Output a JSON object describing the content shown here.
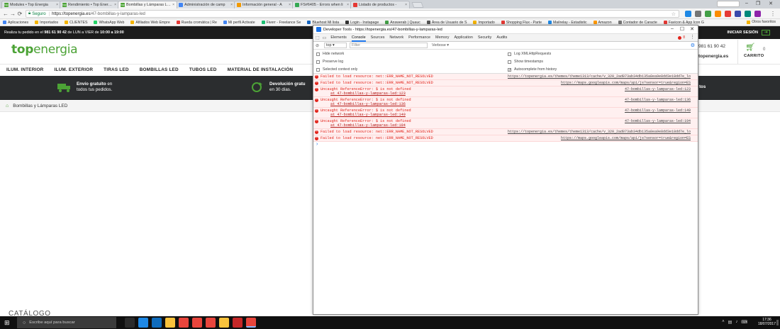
{
  "browser": {
    "tabs": [
      {
        "label": "Modules • Top Energia",
        "favicon_color": "#4ca336",
        "favicon_text": "top",
        "active": false
      },
      {
        "label": "Rendimiento • Top Energia",
        "favicon_color": "#4ca336",
        "favicon_text": "top",
        "active": false
      },
      {
        "label": "Bombillas y Lámparas LED",
        "favicon_color": "#4ca336",
        "favicon_text": "top",
        "active": true
      },
      {
        "label": "Administración de camp",
        "favicon_color": "#4285f4",
        "favicon_text": "",
        "active": false
      },
      {
        "label": "Información general - A",
        "favicon_color": "#f29900",
        "favicon_text": "",
        "active": false
      },
      {
        "label": "FS#6405 - Errors when li",
        "favicon_color": "#34a853",
        "favicon_text": "",
        "active": false
      },
      {
        "label": "Listado de productos - ",
        "favicon_color": "#e53935",
        "favicon_text": "",
        "active": false
      }
    ],
    "address": {
      "secure_label": "Seguro",
      "url_host": "https://topenergia.es",
      "url_path": "/47-bombillas-y-lamparas-led"
    },
    "bookmarks": [
      {
        "label": "Aplicaciones",
        "color": "#4285f4"
      },
      {
        "label": "Importados",
        "color": "#f4b400"
      },
      {
        "label": "CLIENTES",
        "color": "#f4b400"
      },
      {
        "label": "WhatsApp Web",
        "color": "#25d366"
      },
      {
        "label": "Afiliados Web Empre",
        "color": "#f4b400"
      },
      {
        "label": "Rueda cromática | Re",
        "color": "#e53935"
      },
      {
        "label": "Mi perfil Activate",
        "color": "#4285f4"
      },
      {
        "label": "Fiverr - Freelance Se",
        "color": "#1dbf73"
      },
      {
        "label": "Bluehost Mi lista",
        "color": "#1565c0"
      },
      {
        "label": "Login - Instapage",
        "color": "#333333"
      },
      {
        "label": "Answerab | Quauc",
        "color": "#43a047"
      },
      {
        "label": "Área de Usuario de S",
        "color": "#555555"
      },
      {
        "label": "Importado",
        "color": "#f4b400"
      },
      {
        "label": "Shopping Flux - Parte",
        "color": "#e53935"
      },
      {
        "label": "Mailrelay - Estadistic",
        "color": "#1e88e5"
      },
      {
        "label": "Amazon",
        "color": "#ff9900"
      },
      {
        "label": "Contador de Caracte",
        "color": "#777777"
      },
      {
        "label": "Favicon & App Icon G",
        "color": "#e53935"
      }
    ],
    "other_bookmarks": "Otros favoritos"
  },
  "site": {
    "promo_prefix": "Realiza tu pedido en el ",
    "promo_phone": "981 61 90 42",
    "promo_middle": " de LUN a VIER de ",
    "promo_hours": "10:00 a 19:00",
    "login_label": "INICIAR SESIÓN",
    "logo_top": "top",
    "logo_energia": "energia",
    "phone": "981 61 90 42",
    "domain": "topenergia.es",
    "cart_count": "0",
    "cart_label": "CARRITO",
    "nav": [
      "ILUM. INTERIOR",
      "ILUM. EXTERIOR",
      "TIRAS LED",
      "BOMBILLAS LED",
      "TUBOS LED",
      "MATERIAL DE INSTALACIÓN"
    ],
    "benefits": [
      {
        "title": "Envío gratuito",
        "title_suffix": " en",
        "line2": "todos tus pedidos."
      },
      {
        "title": "Devolución gratu",
        "title_suffix": "",
        "line2": "en 30 días."
      },
      {
        "title": "tos",
        "title_suffix": "",
        "line2": ""
      }
    ],
    "breadcrumb": "Bombillas y Lámparas LED",
    "catalog_heading": "CATÁLOGO"
  },
  "devtools": {
    "title": "Developer Tools - https://topenergia.es/47-bombillas-y-lamparas-led",
    "tabs": [
      "Elements",
      "Console",
      "Sources",
      "Network",
      "Performance",
      "Memory",
      "Application",
      "Security",
      "Audits"
    ],
    "active_tab": "Console",
    "error_count": "8",
    "context": "top",
    "filter_placeholder": "Filter",
    "level": "Verbose",
    "options_left": [
      {
        "label": "Hide network",
        "checked": false
      },
      {
        "label": "Preserve log",
        "checked": false
      },
      {
        "label": "Selected context only",
        "checked": false
      }
    ],
    "options_right": [
      {
        "label": "Log XMLHttpRequests",
        "checked": false
      },
      {
        "label": "Show timestamps",
        "checked": false
      },
      {
        "label": "Autocomplete from history",
        "checked": true
      }
    ],
    "messages": [
      {
        "text": "Failed to load resource: net::ERR_NAME_NOT_RESOLVED",
        "source": "https://topenergia.es/themes/theme1313/cache/v_320_2ad873ab34db135a8ea9e8dd3e18dd7e_lo",
        "stack": ""
      },
      {
        "text": "Failed to load resource: net::ERR_NAME_NOT_RESOLVED",
        "source": "https://maps.googleapis.com/maps/api/js?sensor=true&region=ES",
        "stack": ""
      },
      {
        "text": "Uncaught ReferenceError: $ is not defined",
        "source": "47-bombillas-y-lamparas-led:123",
        "stack": "at 47-bombillas-y-lamparas-led:123"
      },
      {
        "text": "Uncaught ReferenceError: $ is not defined",
        "source": "47-bombillas-y-lamparas-led:136",
        "stack": "at 47-bombillas-y-lamparas-led:136"
      },
      {
        "text": "Uncaught ReferenceError: $ is not defined",
        "source": "47-bombillas-y-lamparas-led:149",
        "stack": "at 47-bombillas-y-lamparas-led:149"
      },
      {
        "text": "Uncaught ReferenceError: $ is not defined",
        "source": "47-bombillas-y-lamparas-led:194",
        "stack": "at 47-bombillas-y-lamparas-led:194"
      },
      {
        "text": "Failed to load resource: net::ERR_NAME_NOT_RESOLVED",
        "source": "https://topenergia.es/themes/theme1313/cache/v_320_2ad873ab34db135a8ea9e8dd3e18dd7e_lo",
        "stack": ""
      },
      {
        "text": "Failed to load resource: net::ERR_NAME_NOT_RESOLVED",
        "source": "https://maps.googleapis.com/maps/api/js?sensor=true&region=ES",
        "stack": ""
      }
    ],
    "prompt": "›"
  },
  "taskbar": {
    "search_placeholder": "Escribe aquí para buscar",
    "clock_time": "17:36",
    "clock_date": "18/07/2017",
    "apps": [
      {
        "name": "task-view",
        "color": "#2b2b2b"
      },
      {
        "name": "edge",
        "color": "#1e88e5"
      },
      {
        "name": "outlook",
        "color": "#0f6cbd"
      },
      {
        "name": "file-explorer",
        "color": "#f9c23c"
      },
      {
        "name": "chrome",
        "color": "#e8453c"
      },
      {
        "name": "chrome-2",
        "color": "#e8453c"
      },
      {
        "name": "chrome-3",
        "color": "#e8453c"
      },
      {
        "name": "folder",
        "color": "#f9c23c"
      },
      {
        "name": "filezilla",
        "color": "#c62828"
      },
      {
        "name": "chrome-active",
        "color": "#e8453c"
      }
    ]
  },
  "colors": {
    "brand_green": "#4ca336",
    "dark_bar": "#1c1c1c",
    "benefits_bar": "#2b2d2f",
    "console_error": "#e2231a",
    "devtools_accent": "#1a73e8"
  }
}
